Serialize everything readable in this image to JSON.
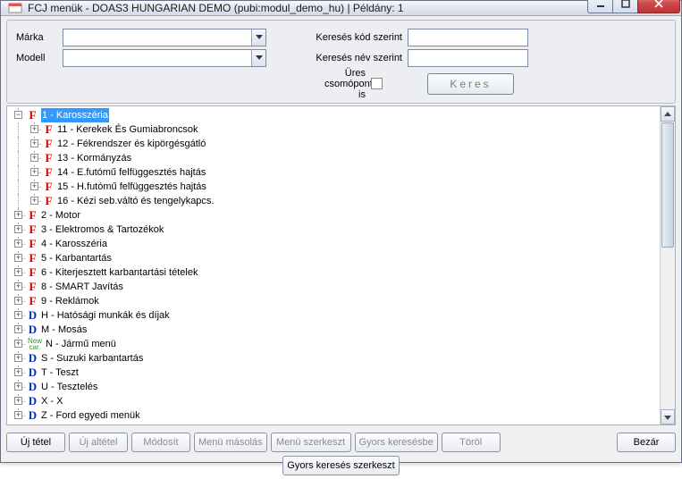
{
  "window": {
    "title": "FCJ menük - DOAS3 HUNGARIAN DEMO (pubi:modul_demo_hu) | Példány: 1"
  },
  "filters": {
    "brand_label": "Márka",
    "model_label": "Modell",
    "search_code_label": "Keresés kód szerint",
    "search_name_label": "Keresés név szerint",
    "empty_nodes_label": "Üres csomópontok is",
    "search_btn": "Keres"
  },
  "tree": [
    {
      "depth": 0,
      "exp": "-",
      "tag": "F",
      "label": "1 - Karosszéria",
      "selected": true
    },
    {
      "depth": 1,
      "exp": "+",
      "tag": "F",
      "label": "11 - Kerekek És Gumiabroncsok"
    },
    {
      "depth": 1,
      "exp": "+",
      "tag": "F",
      "label": "12 - Fékrendszer és kipörgésgátló"
    },
    {
      "depth": 1,
      "exp": "+",
      "tag": "F",
      "label": "13 - Kormányzás"
    },
    {
      "depth": 1,
      "exp": "+",
      "tag": "F",
      "label": "14 - E.futómű felfüggesztés hajtás"
    },
    {
      "depth": 1,
      "exp": "+",
      "tag": "F",
      "label": "15 - H.futómű felfüggesztés hajtás"
    },
    {
      "depth": 1,
      "exp": "+",
      "tag": "F",
      "label": "16 - Kézi seb.váltó és tengelykapcs."
    },
    {
      "depth": 0,
      "exp": "+",
      "tag": "F",
      "label": "2 - Motor"
    },
    {
      "depth": 0,
      "exp": "+",
      "tag": "F",
      "label": "3 - Elektromos & Tartozékok"
    },
    {
      "depth": 0,
      "exp": "+",
      "tag": "F",
      "label": "4 - Karosszéria"
    },
    {
      "depth": 0,
      "exp": "+",
      "tag": "F",
      "label": "5 - Karbantartás"
    },
    {
      "depth": 0,
      "exp": "+",
      "tag": "F",
      "label": "6 - Kiterjesztett karbantartási tételek"
    },
    {
      "depth": 0,
      "exp": "+",
      "tag": "F",
      "label": "8 - SMART Javítás"
    },
    {
      "depth": 0,
      "exp": "+",
      "tag": "F",
      "label": "9 - Reklámok"
    },
    {
      "depth": 0,
      "exp": "+",
      "tag": "D",
      "label": "H - Hatósági munkák és díjak"
    },
    {
      "depth": 0,
      "exp": "+",
      "tag": "D",
      "label": "M - Mosás"
    },
    {
      "depth": 0,
      "exp": "+",
      "tag": "N",
      "label": "N - Jármű menü"
    },
    {
      "depth": 0,
      "exp": "+",
      "tag": "D",
      "label": "S - Suzuki karbantartás"
    },
    {
      "depth": 0,
      "exp": "+",
      "tag": "D",
      "label": "T - Teszt"
    },
    {
      "depth": 0,
      "exp": "+",
      "tag": "D",
      "label": "U - Tesztelés"
    },
    {
      "depth": 0,
      "exp": "+",
      "tag": "D",
      "label": "X - X"
    },
    {
      "depth": 0,
      "exp": "+",
      "tag": "D",
      "label": "Z - Ford egyedi menük"
    }
  ],
  "buttons": {
    "new_item": "Új tétel",
    "new_subitem": "Új altétel",
    "modify": "Módosít",
    "menu_copy": "Menü másolás",
    "menu_edit": "Menü szerkeszt",
    "to_quick": "Gyors keresésbe",
    "delete": "Töröl",
    "close": "Bezár",
    "quick_edit": "Gyors keresés szerkeszt"
  }
}
